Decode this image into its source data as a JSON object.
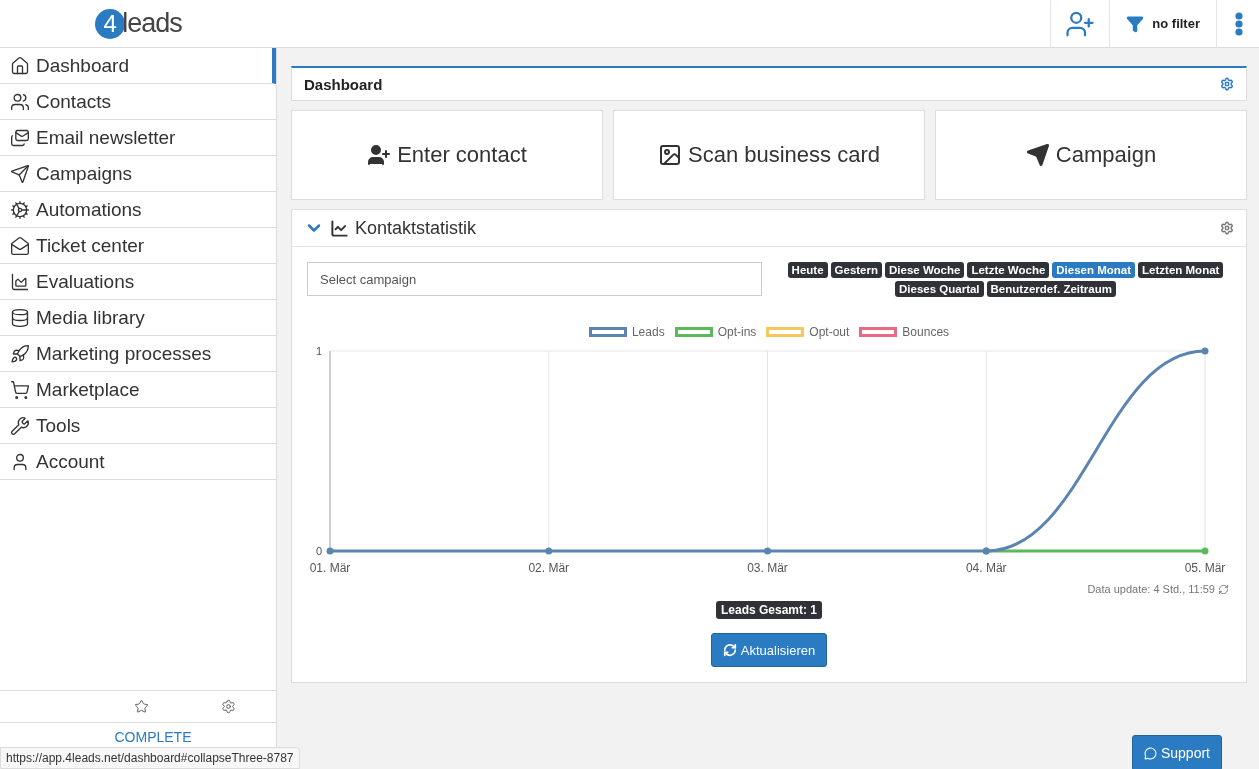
{
  "header": {
    "logo": {
      "mark": "4",
      "text": "leads"
    },
    "filter_label": "no filter"
  },
  "sidebar": {
    "items": [
      {
        "label": "Dashboard",
        "selected": true
      },
      {
        "label": "Contacts",
        "selected": false
      },
      {
        "label": "Email newsletter",
        "selected": false
      },
      {
        "label": "Campaigns",
        "selected": false
      },
      {
        "label": "Automations",
        "selected": false
      },
      {
        "label": "Ticket center",
        "selected": false
      },
      {
        "label": "Evaluations",
        "selected": false
      },
      {
        "label": "Media library",
        "selected": false
      },
      {
        "label": "Marketing processes",
        "selected": false
      },
      {
        "label": "Marketplace",
        "selected": false
      },
      {
        "label": "Tools",
        "selected": false
      },
      {
        "label": "Account",
        "selected": false
      }
    ],
    "footer_text": "COMPLETE"
  },
  "dashboard": {
    "title": "Dashboard",
    "actions": [
      {
        "label": "Enter contact"
      },
      {
        "label": "Scan business card"
      },
      {
        "label": "Campaign"
      }
    ]
  },
  "stats": {
    "title": "Kontaktstatistik",
    "expanded": true,
    "campaign_select": {
      "placeholder": "Select campaign"
    },
    "ranges": [
      {
        "label": "Heute",
        "selected": false
      },
      {
        "label": "Gestern",
        "selected": false
      },
      {
        "label": "Diese Woche",
        "selected": false
      },
      {
        "label": "Letzte Woche",
        "selected": false
      },
      {
        "label": "Diesen Monat",
        "selected": true
      },
      {
        "label": "Letzten Monat",
        "selected": false
      },
      {
        "label": "Dieses Quartal",
        "selected": false
      },
      {
        "label": "Benutzerdef. Zeitraum",
        "selected": false
      }
    ],
    "chart_data": {
      "type": "line",
      "grid": true,
      "categories": [
        "01. Mär",
        "02. Mär",
        "03. Mär",
        "04. Mär",
        "05. Mär"
      ],
      "ylim": [
        0,
        1
      ],
      "yticks": [
        0,
        1
      ],
      "series": [
        {
          "name": "Leads",
          "color": "#5b84b1",
          "marker": true,
          "values": [
            0,
            0,
            0,
            0,
            1
          ]
        },
        {
          "name": "Opt-ins",
          "color": "#5cb85c",
          "marker": true,
          "values": [
            null,
            null,
            null,
            0,
            0
          ]
        },
        {
          "name": "Opt-out",
          "color": "#f5c85b",
          "marker": true,
          "values": [
            null,
            null,
            null,
            null,
            null
          ]
        },
        {
          "name": "Bounces",
          "color": "#ea6a85",
          "marker": true,
          "values": [
            null,
            null,
            null,
            null,
            null
          ]
        }
      ]
    },
    "data_update": "Data update: 4 Std., 11:59",
    "total": "Leads Gesamt: 1",
    "refresh_button": "Aktualisieren"
  },
  "support_button": "Support",
  "status_url": "https://app.4leads.net/dashboard#collapseThree-8787"
}
